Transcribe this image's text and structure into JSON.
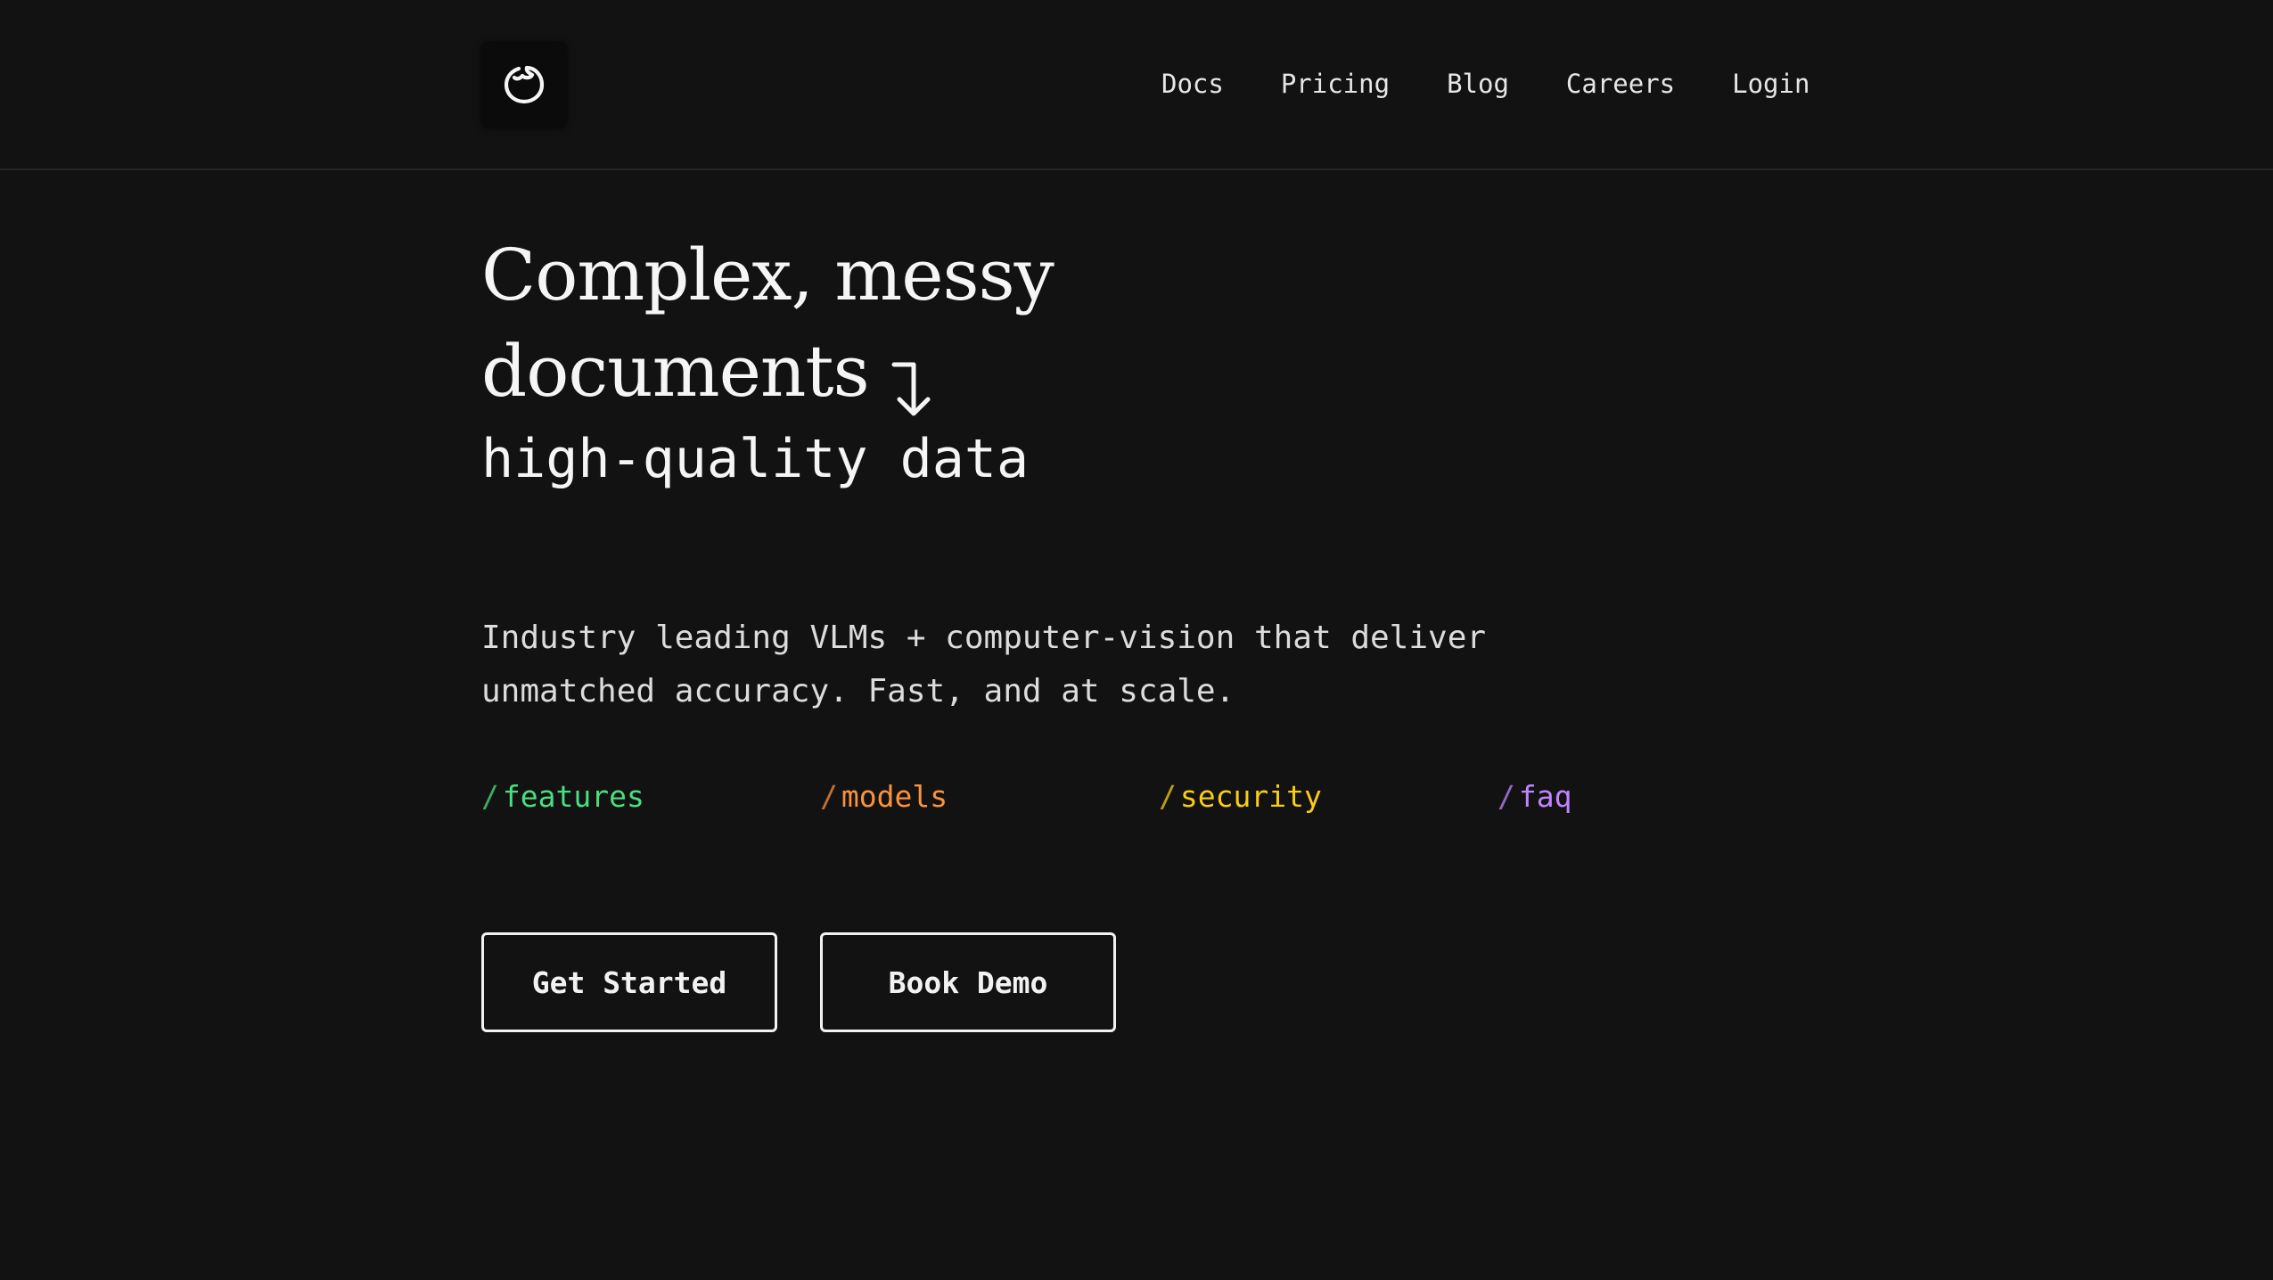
{
  "brand": {
    "logo_icon": "swirl-logo-icon"
  },
  "nav": {
    "items": [
      {
        "label": "Docs"
      },
      {
        "label": "Pricing"
      },
      {
        "label": "Blog"
      },
      {
        "label": "Careers"
      },
      {
        "label": "Login"
      }
    ]
  },
  "hero": {
    "headline_line1": "Complex, messy",
    "headline_line2": "documents",
    "arrow_icon": "arrow-turn-down-icon",
    "subline": "high-quality data",
    "description": "Industry leading VLMs + computer-vision that deliver unmatched accuracy. Fast, and at scale."
  },
  "section_links": [
    {
      "slash": "/",
      "label": "features",
      "color": "#4ade80"
    },
    {
      "slash": "/",
      "label": "models",
      "color": "#fb923c"
    },
    {
      "slash": "/",
      "label": "security",
      "color": "#facc15"
    },
    {
      "slash": "/",
      "label": "faq",
      "color": "#c084fc"
    }
  ],
  "cta": {
    "primary_label": "Get Started",
    "secondary_label": "Book Demo"
  }
}
